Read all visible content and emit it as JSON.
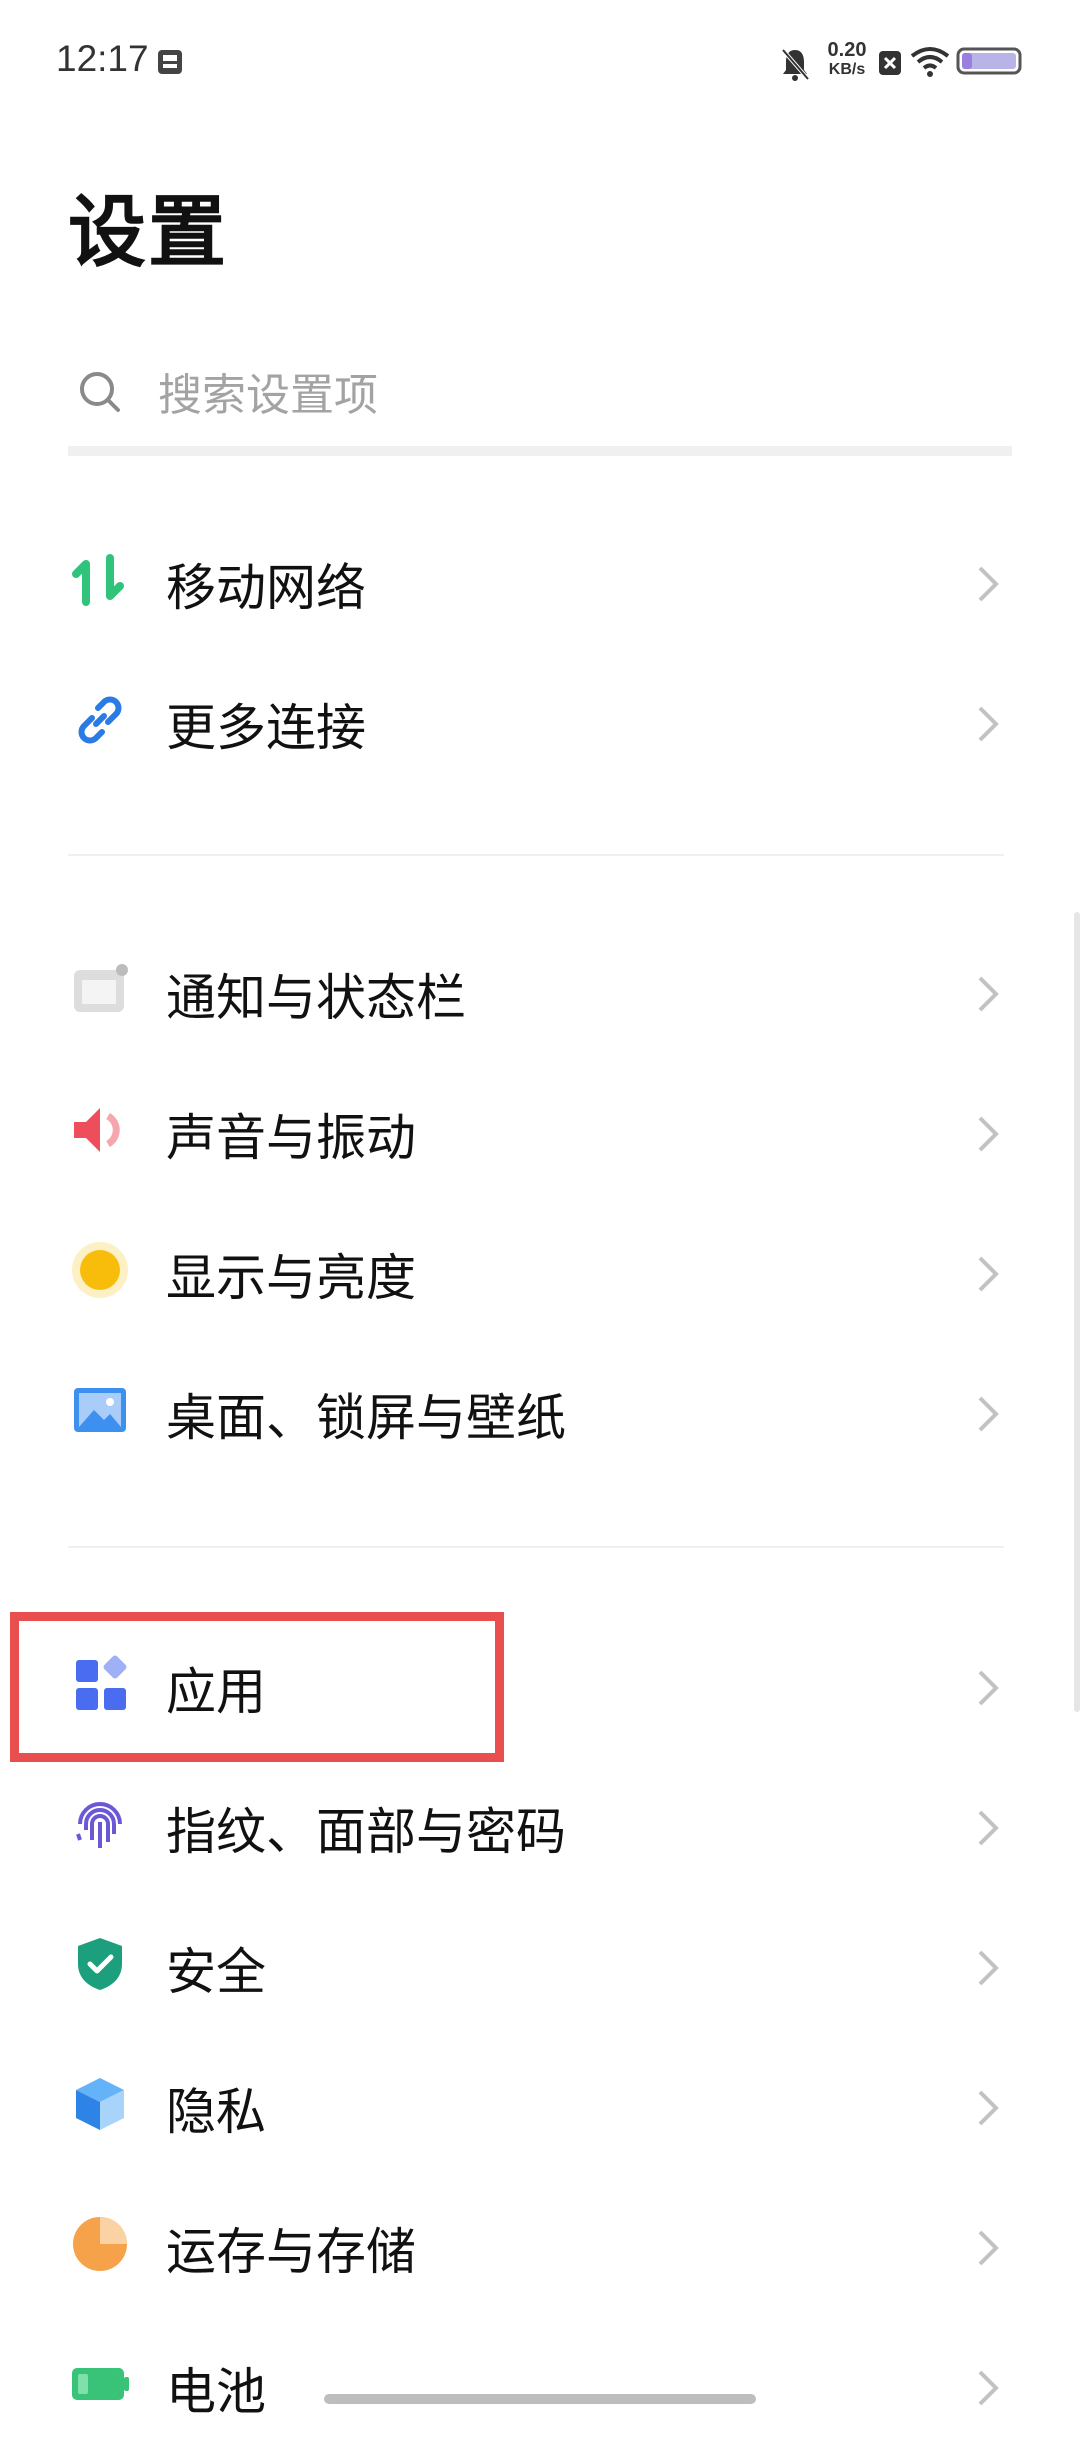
{
  "status_bar": {
    "time": "12:17",
    "speed_value": "0.20",
    "speed_unit": "KB/s"
  },
  "title": "设置",
  "search": {
    "placeholder": "搜索设置项"
  },
  "items": [
    {
      "label": "移动网络",
      "icon": "mobile-network-icon"
    },
    {
      "label": "更多连接",
      "icon": "link-icon"
    },
    {
      "label": "通知与状态栏",
      "icon": "notification-icon"
    },
    {
      "label": "声音与振动",
      "icon": "speaker-icon"
    },
    {
      "label": "显示与亮度",
      "icon": "brightness-icon"
    },
    {
      "label": "桌面、锁屏与壁纸",
      "icon": "wallpaper-icon"
    },
    {
      "label": "应用",
      "icon": "apps-icon"
    },
    {
      "label": "指纹、面部与密码",
      "icon": "fingerprint-icon"
    },
    {
      "label": "安全",
      "icon": "shield-icon"
    },
    {
      "label": "隐私",
      "icon": "privacy-cube-icon"
    },
    {
      "label": "运存与存储",
      "icon": "storage-pie-icon"
    },
    {
      "label": "电池",
      "icon": "battery-icon"
    }
  ],
  "colors": {
    "highlight": "#ea4f4f",
    "network_green": "#2fc37c",
    "link_blue": "#2b7be6",
    "sound_red": "#ee4d5c",
    "brightness_yellow": "#f8bd0b",
    "apps_blue": "#4a6cf0",
    "security_teal": "#1b9f7c",
    "storage_orange": "#f6a24a",
    "battery_green": "#38c379"
  }
}
